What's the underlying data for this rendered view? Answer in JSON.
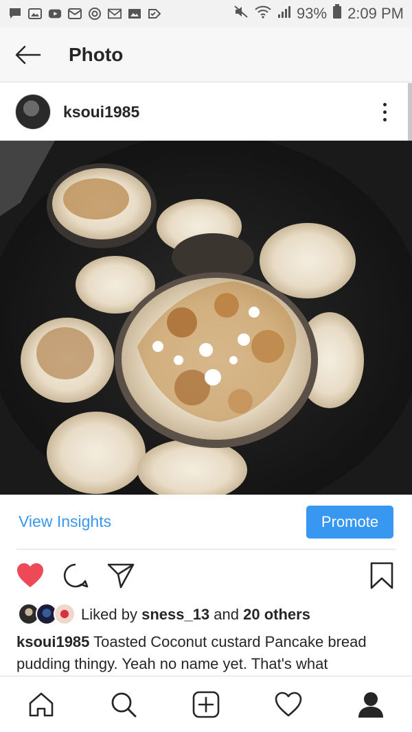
{
  "status_bar": {
    "battery": "93%",
    "time": "2:09 PM",
    "icons_left": [
      "message-icon",
      "image-icon",
      "youtube-icon",
      "gallery-icon",
      "chrome-icon",
      "gmail-icon",
      "photo-icon",
      "check-icon"
    ],
    "icons_right": [
      "mute-icon",
      "wifi-icon",
      "signal-icon",
      "battery-icon"
    ]
  },
  "header": {
    "title": "Photo",
    "back_icon": "arrow-left-icon"
  },
  "post": {
    "username": "ksoui1985",
    "more_icon": "more-vertical-icon"
  },
  "insights": {
    "view_insights_label": "View Insights",
    "promote_label": "Promote"
  },
  "actions": {
    "like_icon": "heart-filled-icon",
    "comment_icon": "comment-icon",
    "share_icon": "send-icon",
    "save_icon": "bookmark-icon",
    "like_color": "#ed4956"
  },
  "likes": {
    "prefix": "Liked by",
    "user": "sness_13",
    "middle": "and",
    "others": "20 others"
  },
  "caption": {
    "username": "ksoui1985",
    "text": "Toasted Coconut custard Pancake  bread pudding thingy. Yeah no name yet. That's what"
  },
  "bottom_nav": {
    "items": [
      "home-icon",
      "search-icon",
      "add-icon",
      "activity-heart-icon",
      "profile-icon"
    ]
  },
  "colors": {
    "accent": "#3897f0",
    "text": "#262626",
    "divider": "#dbdbdb"
  }
}
